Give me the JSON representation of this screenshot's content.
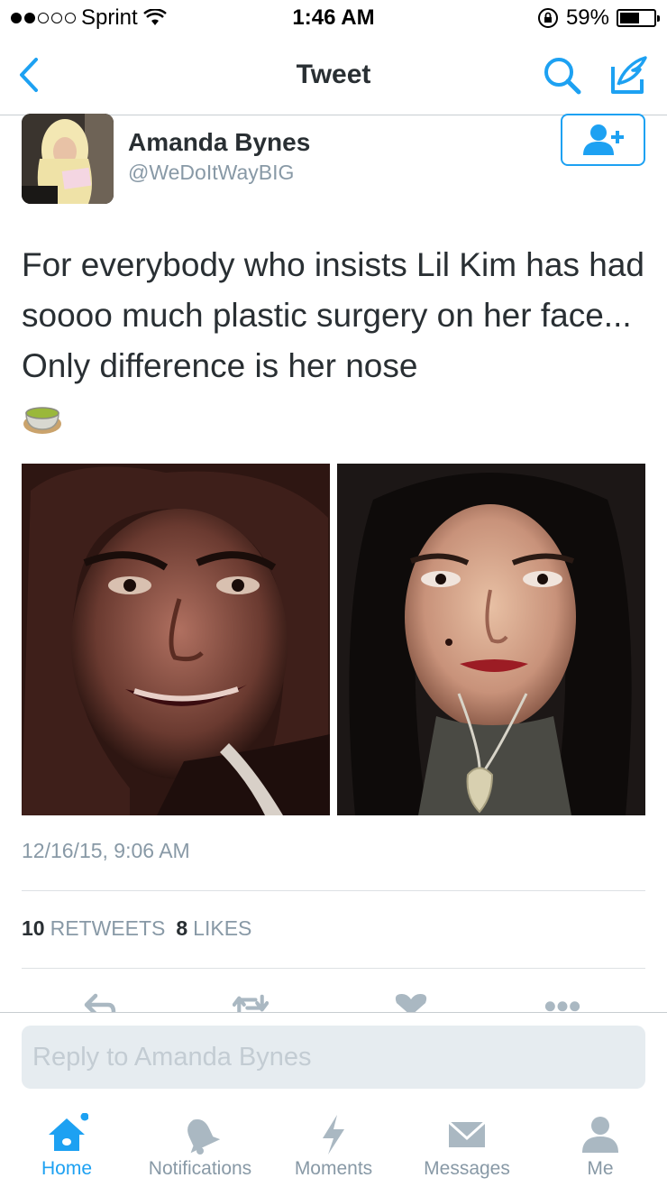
{
  "status_bar": {
    "carrier": "Sprint",
    "time": "1:46 AM",
    "battery_percent": "59%",
    "battery_level": 0.59,
    "signal_bars_filled": 2,
    "signal_bars_total": 5
  },
  "nav": {
    "title": "Tweet",
    "back_icon": "chevron-left-icon",
    "search_icon": "search-icon",
    "compose_icon": "compose-icon"
  },
  "tweet": {
    "author_name": "Amanda Bynes",
    "author_handle": "@WeDoItWayBIG",
    "text": "For everybody who insists Lil Kim has had soooo much plastic surgery on her face... Only difference is her nose",
    "emoji": "tea-emoji",
    "timestamp": "12/16/15, 9:06 AM",
    "retweets_count": "10",
    "retweets_label": "RETWEETS",
    "likes_count": "8",
    "likes_label": "LIKES"
  },
  "reply": {
    "placeholder": "Reply to Amanda Bynes"
  },
  "tabs": [
    {
      "label": "Home",
      "icon": "home-icon",
      "active": true
    },
    {
      "label": "Notifications",
      "icon": "bell-icon",
      "active": false
    },
    {
      "label": "Moments",
      "icon": "lightning-icon",
      "active": false
    },
    {
      "label": "Messages",
      "icon": "envelope-icon",
      "active": false
    },
    {
      "label": "Me",
      "icon": "person-icon",
      "active": false
    }
  ],
  "colors": {
    "accent": "#1da1f2",
    "muted": "#8899a6",
    "text": "#292f33"
  }
}
